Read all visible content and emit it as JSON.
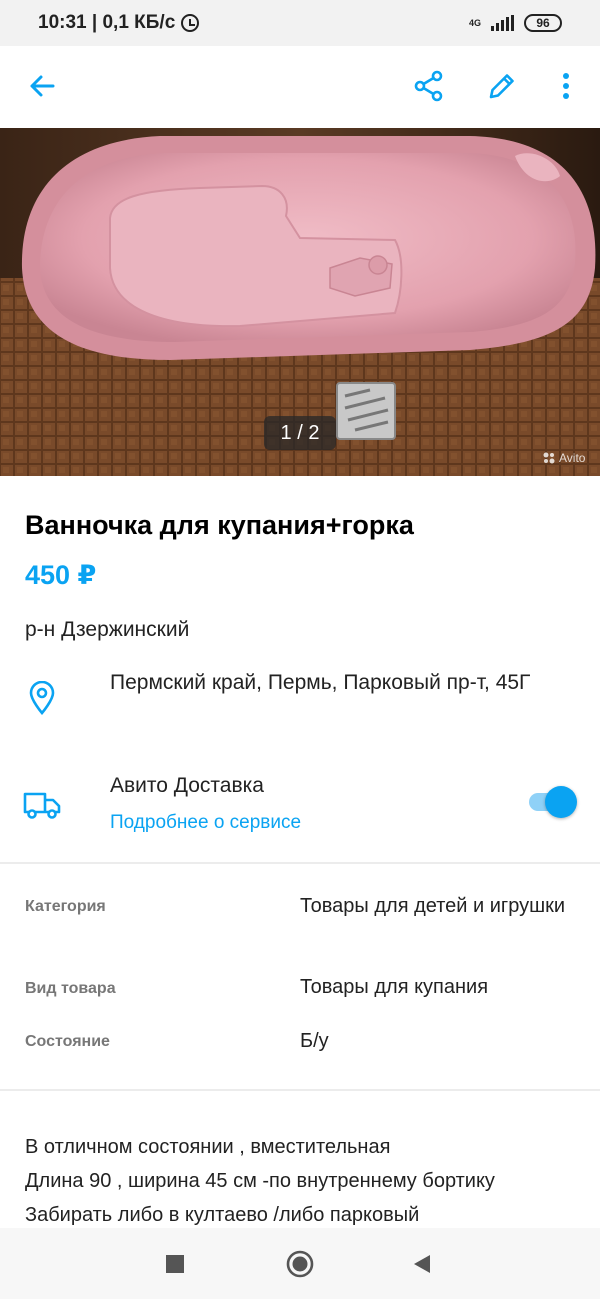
{
  "status_bar": {
    "time_speed": "10:31 | 0,1 КБ/с",
    "network": "4G",
    "battery": "96"
  },
  "toolbar": {
    "back_icon": "arrow-left-icon",
    "share_icon": "share-icon",
    "edit_icon": "pencil-icon",
    "more_icon": "more-vertical-icon",
    "accent": "#0aa3f2"
  },
  "gallery": {
    "counter": "1 / 2",
    "watermark": "Avito"
  },
  "listing": {
    "title": "Ванночка для купания+горка",
    "price": "450 ₽",
    "district": "р-н Дзержинский",
    "address": "Пермский край, Пермь, Парковый пр-т, 45Г"
  },
  "delivery": {
    "title": "Авито Доставка",
    "link": "Подробнее о сервисе",
    "enabled": true
  },
  "params": [
    {
      "label": "Категория",
      "value": "Товары для детей и игрушки"
    },
    {
      "label": "Вид товара",
      "value": "Товары для купания"
    },
    {
      "label": "Состояние",
      "value": "Б/у"
    }
  ],
  "description": [
    "В отличном состоянии , вместительная",
    "Длина 90 , ширина 45 см -по внутреннему бортику",
    "Забирать либо в култаево /либо парковый"
  ],
  "nav_bar": {
    "recents_icon": "square-icon",
    "home_icon": "circle-home-icon",
    "back_icon": "triangle-back-icon"
  }
}
